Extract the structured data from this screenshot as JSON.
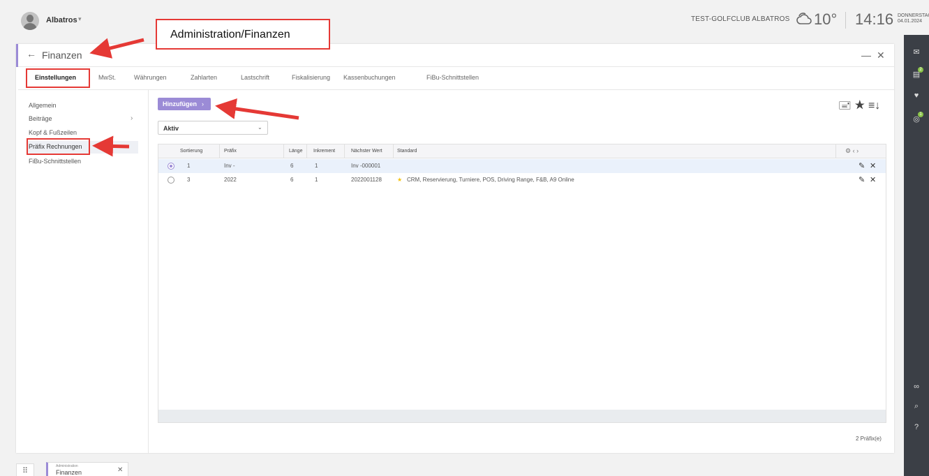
{
  "topbar": {
    "user_name": "Albatros",
    "user_caret": "▾",
    "club": "TEST-GOLFCLUB ALBATROS",
    "temperature": "10°",
    "time": "14:16",
    "day_name": "DONNERSTAG",
    "date": "04.01.2024"
  },
  "panel": {
    "title": "Finanzen",
    "back": "←",
    "minimize": "—",
    "close": "✕"
  },
  "tabs": [
    {
      "label": "Einstellungen",
      "active": true
    },
    {
      "label": "MwSt."
    },
    {
      "label": "Währungen"
    },
    {
      "label": "Zahlarten"
    },
    {
      "label": "Lastschrift"
    },
    {
      "label": "Fiskalisierung"
    },
    {
      "label": "Kassenbuchungen"
    },
    {
      "label": "FiBu-Schnittstellen"
    }
  ],
  "leftnav": [
    {
      "label": "Allgemein"
    },
    {
      "label": "Beiträge",
      "chevron": "›"
    },
    {
      "label": "Kopf & Fußzeilen"
    },
    {
      "label": "Präfix Rechnungen",
      "selected": true
    },
    {
      "label": "FiBu-Schnittstellen"
    }
  ],
  "toolbar": {
    "add_label": "Hinzufügen",
    "add_chevron": "›",
    "filter_value": "Aktiv",
    "filter_caret": "⌄",
    "icons": [
      "inbox-icon",
      "star-icon",
      "sort-icon"
    ],
    "icon_glyphs": "🖃 ★ ≡↓"
  },
  "table": {
    "headers": [
      "Sortierung",
      "Präfix",
      "Länge",
      "Inkrement",
      "Nächster Wert",
      "Standard"
    ],
    "header_icons": "⚙  ‹  ›",
    "rows": [
      {
        "selected": true,
        "sort": "1",
        "prefix": "Inv -",
        "length": "6",
        "increment": "1",
        "next": "Inv -000001",
        "standard": ""
      },
      {
        "selected": false,
        "sort": "3",
        "prefix": "2022",
        "length": "6",
        "increment": "1",
        "next": "2022001128",
        "standard_star": "★",
        "standard": "CRM, Reservierung, Turniere, POS, Driving Range, F&B, A9 Online"
      }
    ],
    "edit_glyph": "✎",
    "delete_glyph": "✕",
    "count": "2 Präfix(e)"
  },
  "taskbar": {
    "grid_glyph": "⠿",
    "tab_sub": "Administration",
    "tab_main": "Finanzen",
    "tab_close": "✕"
  },
  "annotation": {
    "callout": "Administration/Finanzen",
    "color": "#e53935"
  },
  "colors": {
    "accent": "#9b8bd6",
    "sidebar": "#3b3f46",
    "badge": "#8bc34a"
  }
}
